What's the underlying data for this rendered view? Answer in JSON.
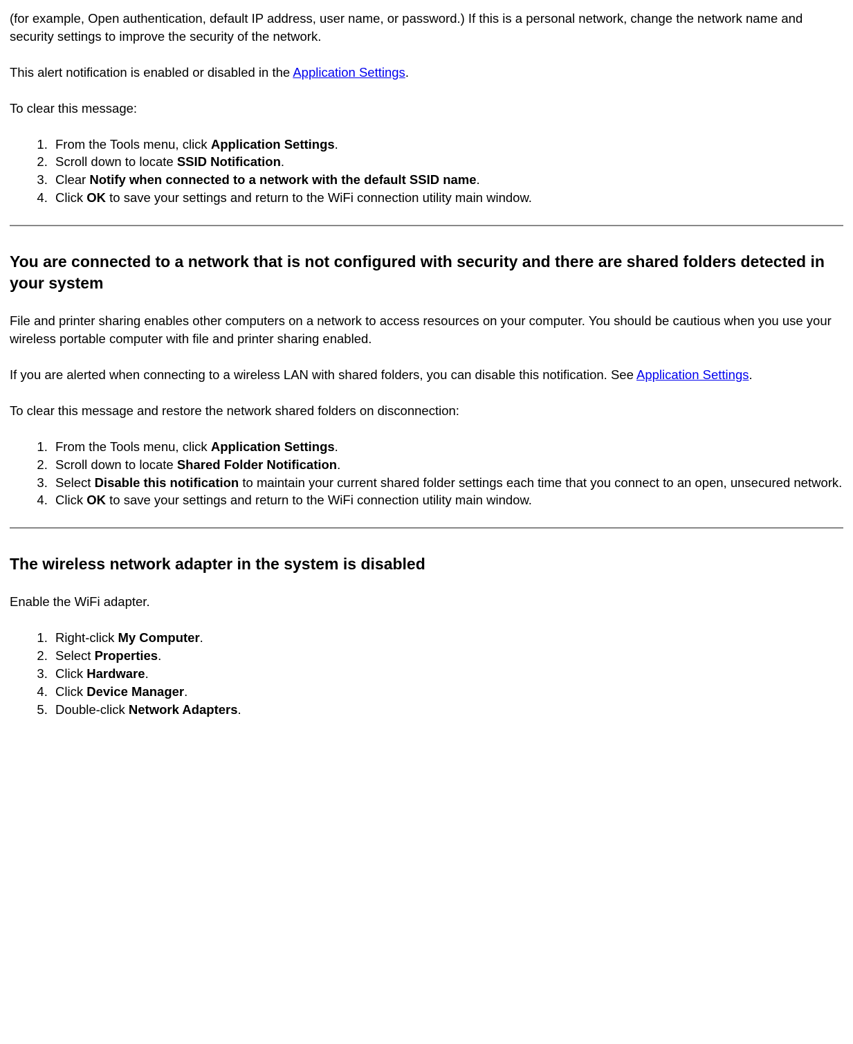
{
  "section1": {
    "intro_para": "(for example, Open authentication, default IP address, user name, or password.) If this is a personal network, change the network name and security settings to improve the security of the network.",
    "alert_para_before": "This alert notification is enabled or disabled in the ",
    "alert_link": "Application Settings",
    "alert_para_after": ".",
    "clear_intro": "To clear this message:",
    "steps": {
      "s1_before": "From the Tools menu, click ",
      "s1_bold": "Application Settings",
      "s1_after": ".",
      "s2_before": "Scroll down to locate ",
      "s2_bold": "SSID Notification",
      "s2_after": ".",
      "s3_before": "Clear ",
      "s3_bold": "Notify when connected to a network with the default SSID name",
      "s3_after": ".",
      "s4_before": "Click ",
      "s4_bold": "OK",
      "s4_after": " to save your settings and return to the WiFi connection utility main window."
    }
  },
  "section2": {
    "heading": "You are connected to a network that is not configured with security and there are shared folders detected in your system",
    "para1": "File and printer sharing enables other computers on a network to access resources on your computer. You should be cautious when you use your wireless portable computer with file and printer sharing enabled.",
    "para2_before": "If you are alerted when connecting to a wireless LAN with shared folders, you can disable this notification. See ",
    "para2_link": "Application Settings",
    "para2_after": ".",
    "clear_intro": "To clear this message and restore the network shared folders on disconnection:",
    "steps": {
      "s1_before": "From the Tools menu, click ",
      "s1_bold": "Application Settings",
      "s1_after": ".",
      "s2_before": "Scroll down to locate ",
      "s2_bold": "Shared Folder Notification",
      "s2_after": ".",
      "s3_before": "Select ",
      "s3_bold": "Disable this notification",
      "s3_after": " to maintain your current shared folder settings each time that you connect to an open, unsecured network.",
      "s4_before": "Click ",
      "s4_bold": "OK",
      "s4_after": " to save your settings and return to the WiFi connection utility main window."
    }
  },
  "section3": {
    "heading": "The wireless network adapter in the system is disabled",
    "para1": "Enable the WiFi adapter.",
    "steps": {
      "s1_before": "Right-click ",
      "s1_bold": "My Computer",
      "s1_after": ".",
      "s2_before": "Select ",
      "s2_bold": "Properties",
      "s2_after": ".",
      "s3_before": "Click ",
      "s3_bold": "Hardware",
      "s3_after": ".",
      "s4_before": "Click ",
      "s4_bold": "Device Manager",
      "s4_after": ".",
      "s5_before": "Double-click ",
      "s5_bold": "Network Adapters",
      "s5_after": "."
    }
  }
}
